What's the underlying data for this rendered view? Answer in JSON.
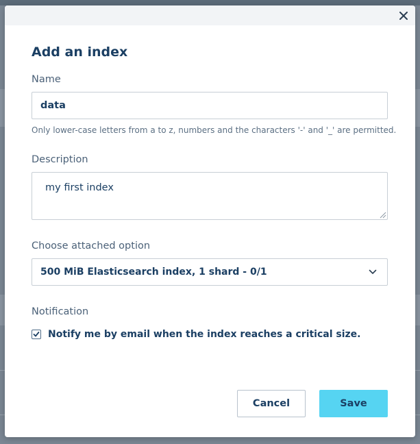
{
  "dialog": {
    "title": "Add an index",
    "close_icon": "close-icon"
  },
  "form": {
    "name": {
      "label": "Name",
      "value": "data",
      "hint": "Only lower-case letters from a to z, numbers and the characters '-' and '_' are permitted."
    },
    "description": {
      "label": "Description",
      "value": "my first index"
    },
    "attached_option": {
      "label": "Choose attached option",
      "selected": "500 MiB Elasticsearch index, 1 shard - 0/1"
    },
    "notification": {
      "label": "Notification",
      "checkbox_label": "Notify me by email when the index reaches a critical size.",
      "checked": true
    }
  },
  "actions": {
    "cancel_label": "Cancel",
    "save_label": "Save"
  },
  "colors": {
    "accent": "#56d4f2",
    "text": "#1b3f63",
    "overlay": "#7b8794"
  }
}
